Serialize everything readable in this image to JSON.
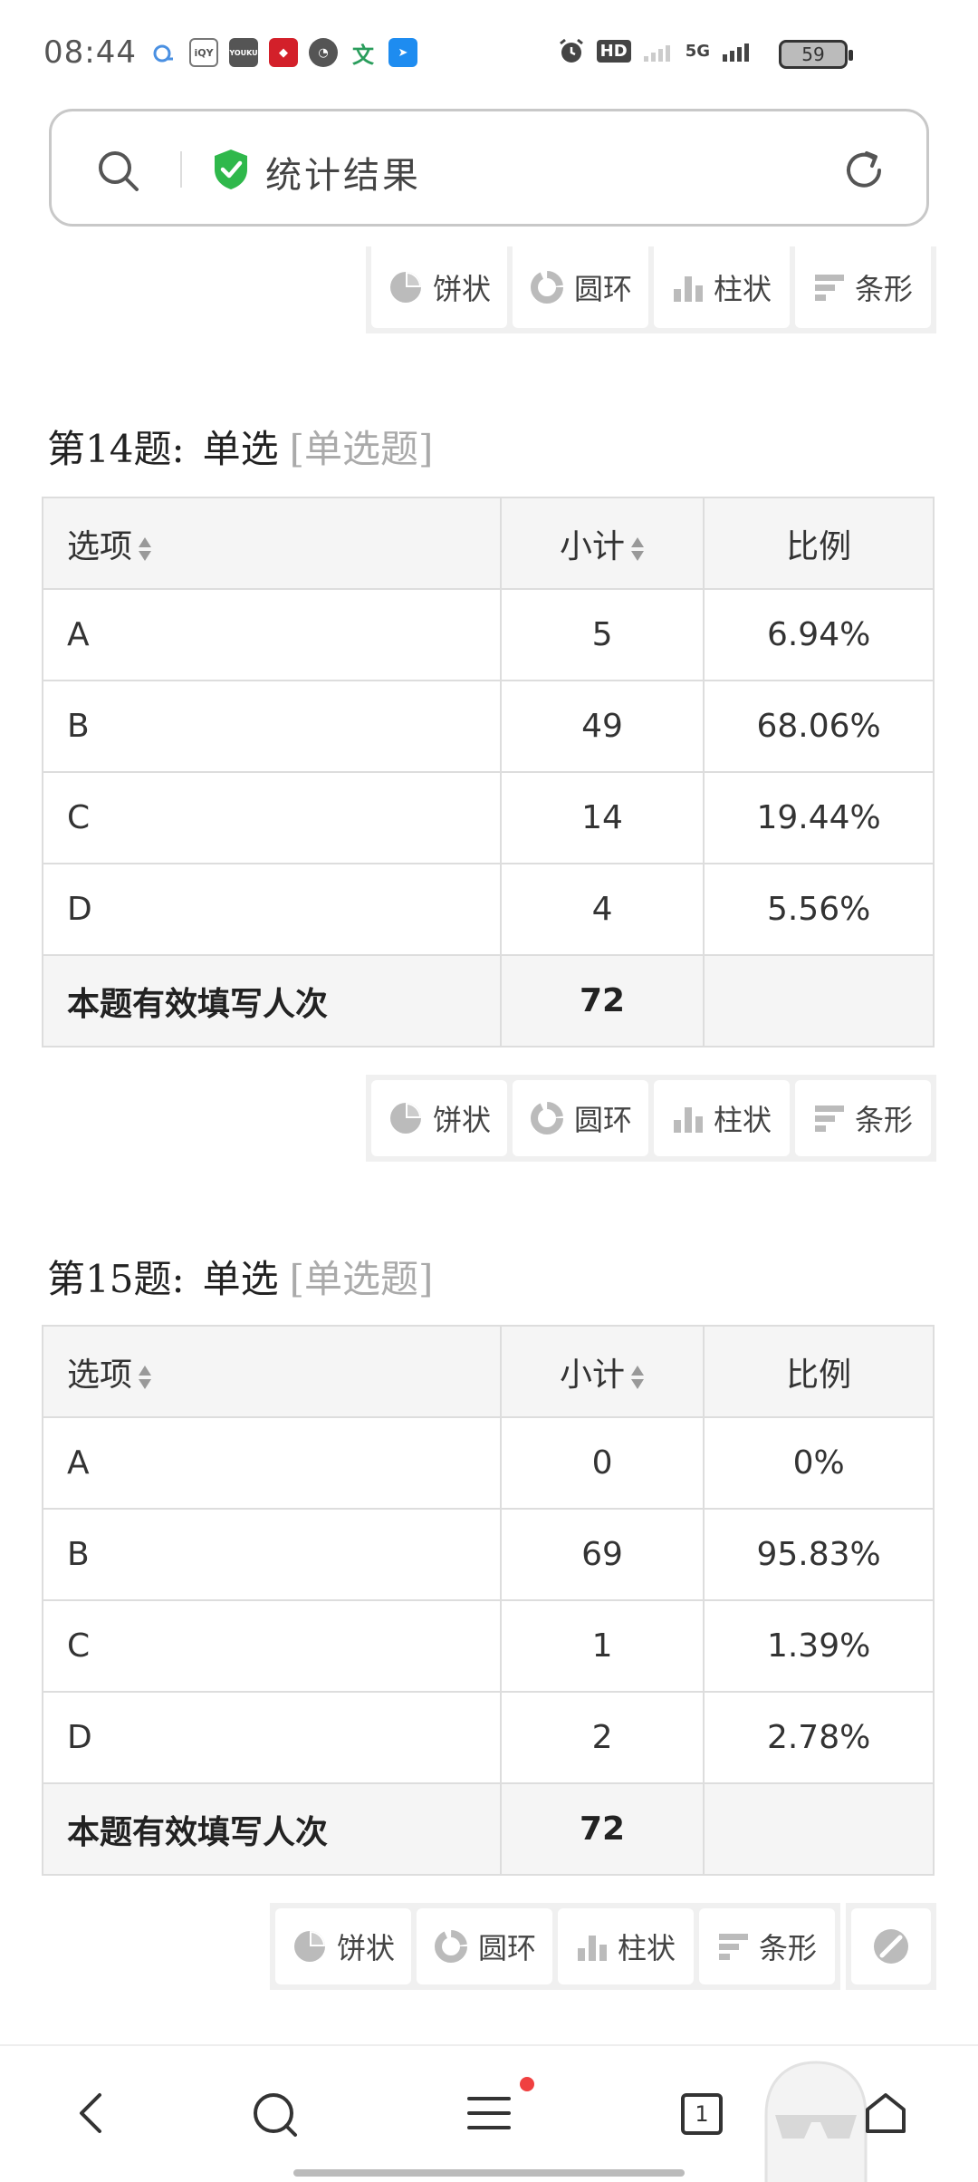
{
  "status_bar": {
    "time": "08:44",
    "network": "5G",
    "hd": "HD",
    "battery": "59"
  },
  "search_bar": {
    "title": "统计结果"
  },
  "chart_buttons": {
    "pie": "饼状",
    "ring": "圆环",
    "column": "柱状",
    "bar": "条形"
  },
  "questions": [
    {
      "number": "第14题",
      "separator": ":",
      "name": "单选",
      "type": "[单选题]",
      "headers": {
        "option": "选项",
        "count": "小计",
        "ratio": "比例"
      },
      "rows": [
        {
          "option": "A",
          "count": "5",
          "ratio": "6.94%"
        },
        {
          "option": "B",
          "count": "49",
          "ratio": "68.06%"
        },
        {
          "option": "C",
          "count": "14",
          "ratio": "19.44%"
        },
        {
          "option": "D",
          "count": "4",
          "ratio": "5.56%"
        }
      ],
      "total_label": "本题有效填写人次",
      "total_value": "72"
    },
    {
      "number": "第15题",
      "separator": ":",
      "name": "单选",
      "type": "[单选题]",
      "headers": {
        "option": "选项",
        "count": "小计",
        "ratio": "比例"
      },
      "rows": [
        {
          "option": "A",
          "count": "0",
          "ratio": "0%"
        },
        {
          "option": "B",
          "count": "69",
          "ratio": "95.83%"
        },
        {
          "option": "C",
          "count": "1",
          "ratio": "1.39%"
        },
        {
          "option": "D",
          "count": "2",
          "ratio": "2.78%"
        }
      ],
      "total_label": "本题有效填写人次",
      "total_value": "72"
    }
  ],
  "bottom_nav": {
    "tab_count": "1"
  },
  "colors": {
    "accent_green": "#2fb84b",
    "notification_dot": "#f04040"
  }
}
